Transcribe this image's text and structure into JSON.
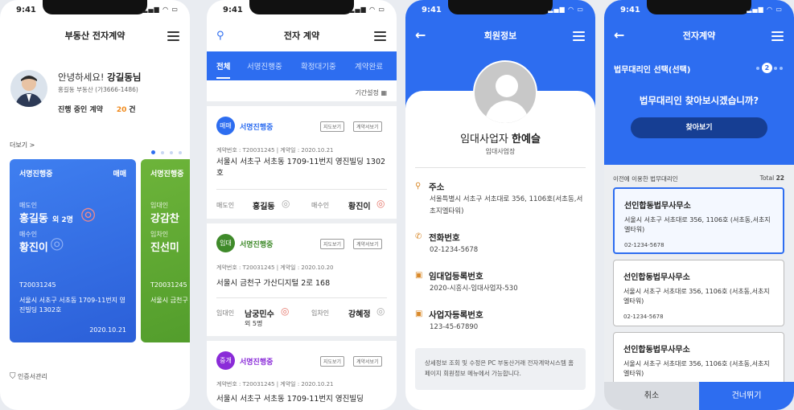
{
  "status_time": "9:41",
  "screen1": {
    "title": "부동산 전자계약",
    "greeting": "안녕하세요!",
    "user_name": "강길동님",
    "agency": "홍길동 부동산 (가3666-1486)",
    "ongoing_label": "진행 중인 계약",
    "ongoing_count": "20",
    "ongoing_unit": "건",
    "more_label": "더보기 >",
    "card1": {
      "status": "서명진행중",
      "type": "매매",
      "seller_label": "매도인",
      "seller": "홍길동",
      "seller_extra": "외 2명",
      "buyer_label": "매수인",
      "buyer": "황진이",
      "contract_no": "T20031245",
      "address": "서울시 서초구 서초동 1709-11번지 영진빌딩 1302호",
      "date": "2020.10.21"
    },
    "card2": {
      "status": "서명진행중",
      "lessor_label": "임대인",
      "lessor": "강감찬",
      "lessee_label": "임차인",
      "lessee": "진선미",
      "contract_no": "T20031245",
      "address": "서울시 금천구"
    },
    "cert_label": "인증서관리"
  },
  "screen2": {
    "title": "전자 계약",
    "tabs": [
      "전체",
      "서명진행중",
      "확정대기중",
      "계약완료"
    ],
    "period_label": "기간설정",
    "map_btn": "지도보기",
    "doc_btn": "계약서보기",
    "items": [
      {
        "badge": "매매",
        "status": "서명진행중",
        "meta": "계약번호 : T20031245  |  계약일 : 2020.10.21",
        "address": "서울시 서초구 서초동 1709-11번지 영진빌딩 1302호",
        "p1_label": "매도인",
        "p1": "홍길동",
        "p1_extra": "",
        "p2_label": "매수인",
        "p2": "황진이"
      },
      {
        "badge": "임대",
        "status": "서명진행중",
        "meta": "계약번호 : T20031245  |  계약일 : 2020.10.20",
        "address": "서울시 금천구 가산디지털 2로 168",
        "p1_label": "임대인",
        "p1": "남궁민수",
        "p1_extra": "외 5명",
        "p2_label": "임차인",
        "p2": "강혜정"
      },
      {
        "badge": "중개",
        "status": "서명진행중",
        "meta": "계약번호 : T20031245  |  계약일 : 2020.10.21",
        "address": "서울시 서초구 서초동 1709-11번지 영진빌딩",
        "p1_label": "",
        "p1": "",
        "p1_extra": "",
        "p2_label": "",
        "p2": ""
      }
    ]
  },
  "screen3": {
    "title": "회원정보",
    "role": "임대사업자",
    "name": "한예슬",
    "sub": "임대사업장",
    "fields": [
      {
        "label": "주소",
        "value": "서울특별시 서초구 서초대로 356, 1106호(서초동,서초지엘타워)"
      },
      {
        "label": "전화번호",
        "value": "02-1234-5678"
      },
      {
        "label": "임대업등록번호",
        "value": "2020-시흥시-임대사업자-530"
      },
      {
        "label": "사업자등록번호",
        "value": "123-45-67890"
      }
    ],
    "notice": "상세정보 조회 및 수정은 PC 부동산거래 전자계약시스템 홈페이지 회원정보 메뉴에서 가능합니다."
  },
  "screen4": {
    "title": "전자계약",
    "step_label": "법무대리인 선택(선택)",
    "step_number": "2",
    "question": "법무대리인 찾아보시겠습니까?",
    "search_btn": "찾아보기",
    "prev_label": "이전에 이용한 법무대리인",
    "total_label": "Total",
    "total_count": "22",
    "firms": [
      {
        "name": "선인합동법무사무소",
        "addr": "서울시 서초구 서초대로 356, 1106호 (서초동,서초지엘타워)",
        "phone": "02-1234-5678"
      },
      {
        "name": "선인합동법무사무소",
        "addr": "서울시 서초구 서초대로 356, 1106호 (서초동,서초지엘타워)",
        "phone": "02-1234-5678"
      },
      {
        "name": "선인합동법무사무소",
        "addr": "서울시 서초구 서초대로 356, 1106호 (서초동,서초지엘타워)",
        "phone": ""
      }
    ],
    "cancel_btn": "취소",
    "skip_btn": "건너뛰기"
  }
}
